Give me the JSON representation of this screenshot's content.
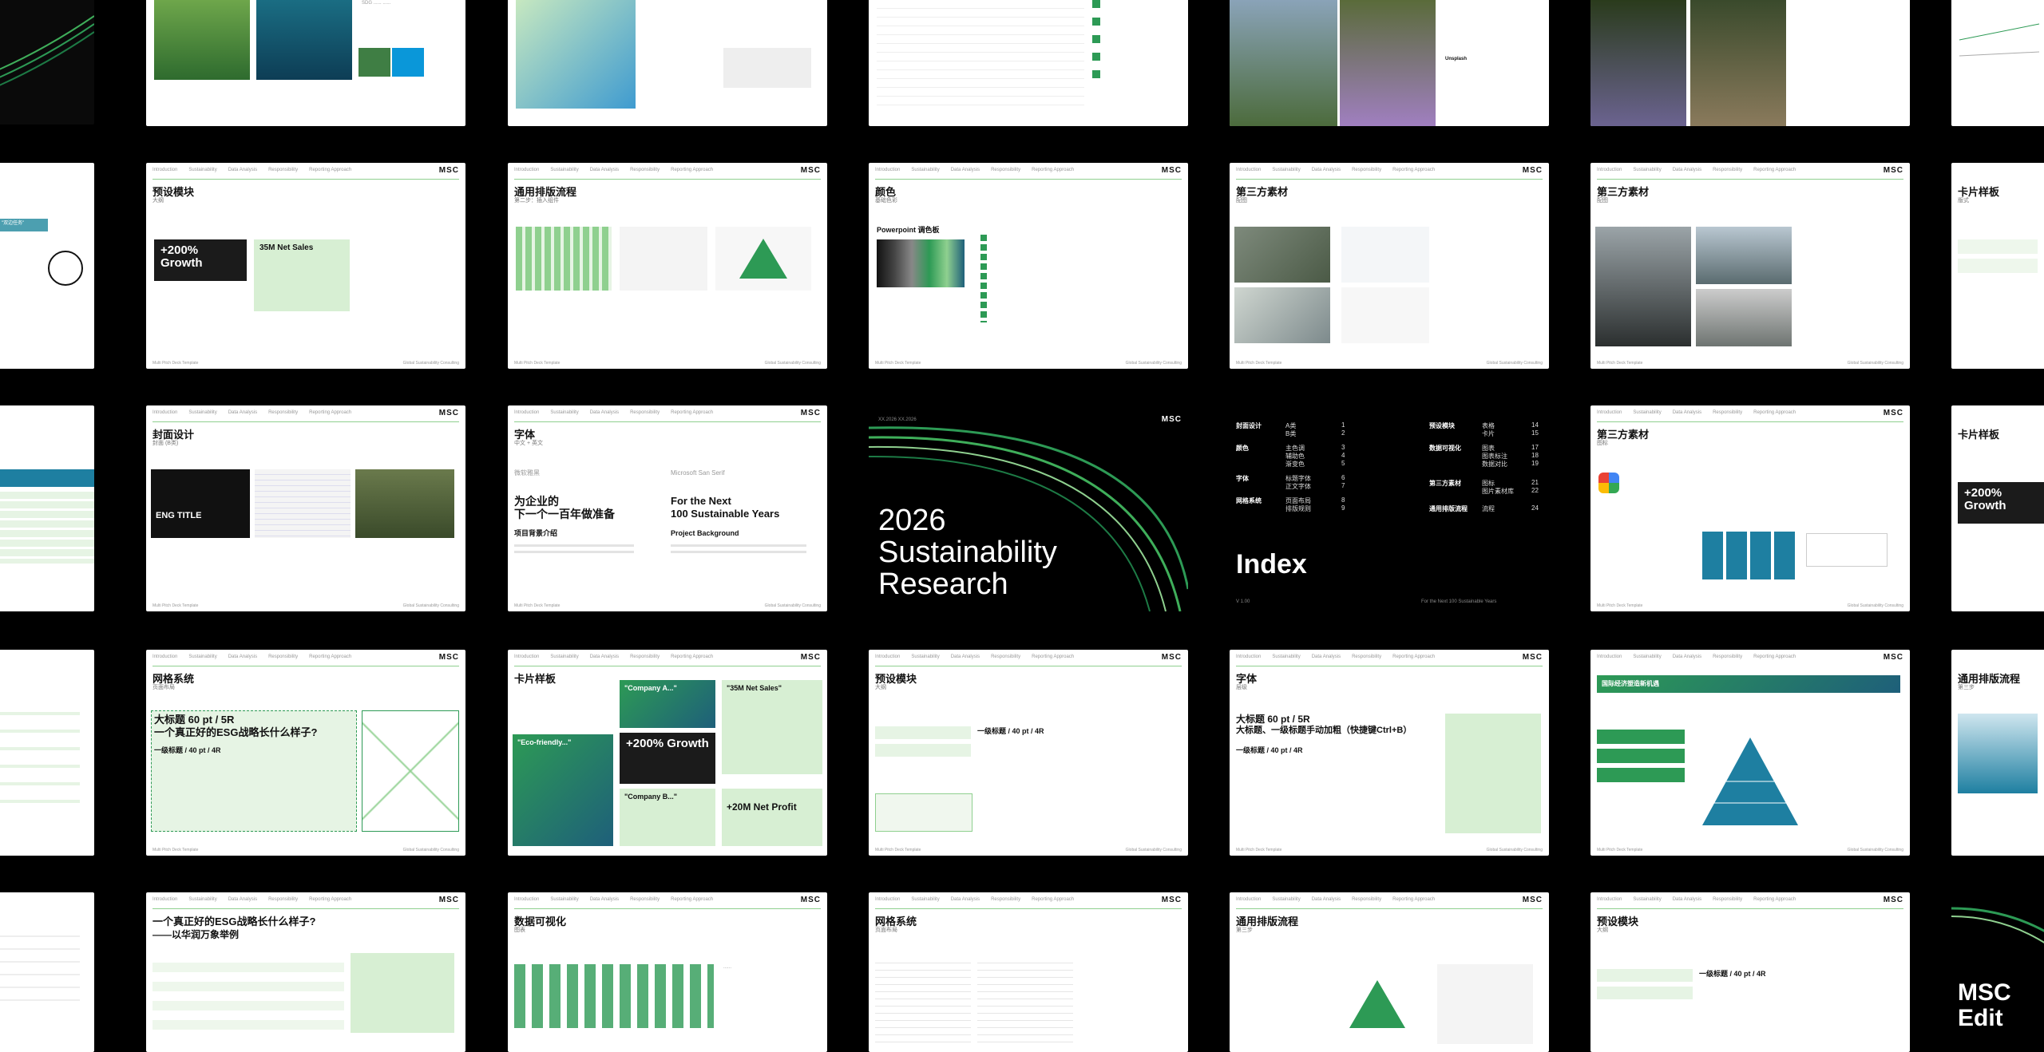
{
  "logo": "MSC",
  "nav": [
    "Introduction",
    "Sustainability",
    "Data Analysis",
    "Responsibility",
    "Reporting Approach"
  ],
  "footer": {
    "left": "Multi Pitch Deck Template",
    "mid": "Global Sustainability Consulting"
  },
  "cover": {
    "date": "XX.2026 XX.2026",
    "title_lines": [
      "2026",
      "Sustainability",
      "Research"
    ]
  },
  "index": {
    "title": "Index",
    "version": "V 1.00",
    "footnote": "For the Next 100 Sustainable Years",
    "col1": [
      {
        "head": "封面设计",
        "items": [
          "A类",
          "B类"
        ],
        "nums": [
          "1",
          "2"
        ]
      },
      {
        "head": "颜色",
        "items": [
          "主色调",
          "辅助色",
          "渐变色"
        ],
        "nums": [
          "3",
          "4",
          "5"
        ]
      },
      {
        "head": "字体",
        "items": [
          "标题字体",
          "正文字体"
        ],
        "nums": [
          "6",
          "7"
        ]
      },
      {
        "head": "网格系统",
        "items": [
          "页面布局",
          "排版规则"
        ],
        "nums": [
          "8",
          "9"
        ]
      }
    ],
    "col2": [
      {
        "head": "预设模块",
        "items": [
          "表格",
          "卡片"
        ],
        "nums": [
          "14",
          "15"
        ]
      },
      {
        "head": "数据可视化",
        "items": [
          "图表",
          "图表标注",
          "数据对比"
        ],
        "nums": [
          "17",
          "18",
          "19"
        ]
      },
      {
        "head": "第三方素材",
        "items": [
          "图标",
          "图片素材库"
        ],
        "nums": [
          "21",
          "22"
        ]
      },
      {
        "head": "通用排版流程",
        "items": [
          "流程"
        ],
        "nums": [
          "24"
        ]
      }
    ]
  },
  "slides": {
    "r1c2": {
      "title": ""
    },
    "r2c1": {
      "title": "预设模块",
      "sub": "大纲",
      "stat": "+200% Growth",
      "stat2": "35M Net Sales"
    },
    "r2c2": {
      "title": "通用排版流程",
      "sub": "第二步：插入组件"
    },
    "r2c3": {
      "title": "颜色",
      "sub": "基础色彩",
      "box": "Powerpoint 调色板"
    },
    "r2c4": {
      "title": "第三方素材",
      "sub": "配图"
    },
    "r2c5": {
      "title": "第三方素材",
      "sub": "配图"
    },
    "r2c6": {
      "title": "卡片样板",
      "sub": "版式"
    },
    "r3c1": {
      "title": "封面设计",
      "sub": "封面 (B类)",
      "eng": "ENG TITLE"
    },
    "r3c2": {
      "title": "字体",
      "sub": "中文 + 英文",
      "cn1": "为企业的",
      "cn2": "下一个一百年做准备",
      "cn3": "项目背景介绍",
      "en1": "For the Next",
      "en2": "100 Sustainable Years",
      "en3": "Project Background",
      "font_label": "Microsoft San Serif",
      "font_label_cn": "微软雅黑"
    },
    "r3c5": {
      "title": "第三方素材",
      "sub": "图标"
    },
    "r3c6": {
      "title": "卡片样板",
      "sub": "",
      "stat": "+200% Growth"
    },
    "r4c1": {
      "title": "网格系统",
      "sub": "页面布局",
      "h1": "大标题 60 pt / 5R",
      "h2": "一个真正好的ESG战略长什么样子?",
      "h3": "一级标题 / 40 pt / 4R"
    },
    "r4c2": {
      "title": "卡片样板",
      "sub": "",
      "q1": "\"Company A...\"",
      "q2": "\"35M Net Sales\"",
      "q3": "\"Eco-friendly...\"",
      "q4": "+200% Growth",
      "q5": "\"Company B...\"",
      "q6": "+20M Net Profit"
    },
    "r4c3": {
      "title": "预设模块",
      "sub": "大纲",
      "row1": "一级标题 / 40 pt / 4R"
    },
    "r4c4": {
      "title": "字体",
      "sub": "层级",
      "big": "大标题 60 pt / 5R",
      "big2": "大标题、一级标题手动加粗（快捷键Ctrl+B）",
      "lvl1": "一级标题 / 40 pt / 4R"
    },
    "r4c5": {
      "title": "国际经济塑造新机遇",
      "sub": ""
    },
    "r4c6": {
      "title": "通用排版流程",
      "sub": "第三步"
    },
    "r5c1": {
      "title": "一个真正好的ESG战略长什么样子?",
      "sub": "——以华润万象举例"
    },
    "r5c2": {
      "title": "数据可视化",
      "sub": "图表"
    },
    "r5c3": {
      "title": "网格系统",
      "sub": "页面布局"
    },
    "r5c4": {
      "title": "通用排版流程",
      "sub": "第三步"
    },
    "r5c5": {
      "title": "预设模块",
      "sub": "大纲",
      "row1": "一级标题 / 40 pt / 4R"
    },
    "r5c6": {
      "title": "MSC Edit"
    }
  },
  "colors": {
    "accent": "#2d9a55",
    "bg": "#000000",
    "rule": "#8fd08f"
  }
}
